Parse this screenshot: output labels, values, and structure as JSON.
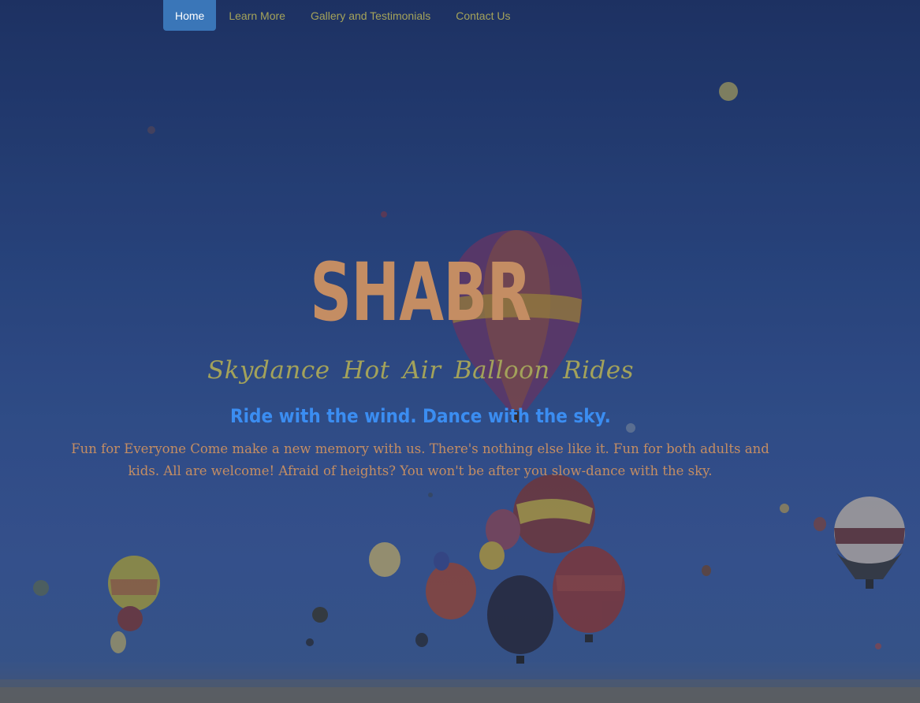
{
  "nav": {
    "items": [
      {
        "label": "Home",
        "active": true
      },
      {
        "label": "Learn More",
        "active": false
      },
      {
        "label": "Gallery and Testimonials",
        "active": false
      },
      {
        "label": "Contact Us",
        "active": false
      }
    ]
  },
  "hero": {
    "title": "SHABR",
    "subtitle": "Skydance Hot Air Balloon Rides",
    "tagline": "Ride with the wind. Dance with the sky.",
    "description": "Fun for Everyone Come make a new memory with us. There's nothing else like it. Fun for both adults and kids. All are welcome! Afraid of heights? You won't be after you slow-dance with the sky."
  },
  "colors": {
    "nav_active_bg": "#3a76b8",
    "nav_text": "#a5a35a",
    "title": "#c48d63",
    "subtitle": "#a3a25a",
    "tagline": "#3b8df1",
    "description": "#c48d63",
    "sky": "#2a4680"
  }
}
